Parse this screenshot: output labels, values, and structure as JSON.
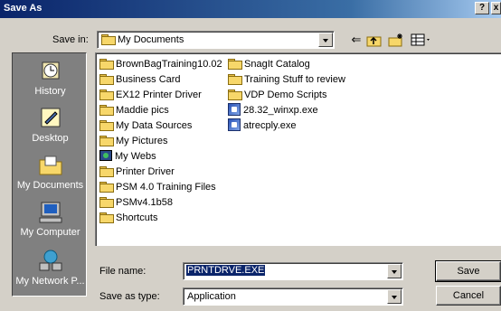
{
  "window": {
    "title": "Save As",
    "help_label": "?",
    "close_label": "x"
  },
  "save_in": {
    "label": "Save in:",
    "value": "My Documents"
  },
  "places": [
    {
      "label": "History",
      "icon": "history-icon"
    },
    {
      "label": "Desktop",
      "icon": "desktop-icon"
    },
    {
      "label": "My Documents",
      "icon": "my-documents-icon"
    },
    {
      "label": "My Computer",
      "icon": "my-computer-icon"
    },
    {
      "label": "My Network P...",
      "icon": "my-network-places-icon"
    }
  ],
  "files": {
    "col1": [
      {
        "name": "BrownBagTraining10.02",
        "icon": "folder"
      },
      {
        "name": "Business Card",
        "icon": "folder"
      },
      {
        "name": "EX12 Printer Driver",
        "icon": "folder"
      },
      {
        "name": "Maddie pics",
        "icon": "folder"
      },
      {
        "name": "My Data Sources",
        "icon": "folder"
      },
      {
        "name": "My Pictures",
        "icon": "folder"
      },
      {
        "name": "My Webs",
        "icon": "web"
      },
      {
        "name": "Printer Driver",
        "icon": "folder"
      },
      {
        "name": "PSM 4.0 Training Files",
        "icon": "folder"
      },
      {
        "name": "PSMv4.1b58",
        "icon": "folder"
      },
      {
        "name": "Shortcuts",
        "icon": "folder"
      }
    ],
    "col2": [
      {
        "name": "SnagIt Catalog",
        "icon": "folder"
      },
      {
        "name": "Training Stuff to review",
        "icon": "folder"
      },
      {
        "name": "VDP Demo Scripts",
        "icon": "folder"
      },
      {
        "name": "28.32_winxp.exe",
        "icon": "exe"
      },
      {
        "name": "atrecply.exe",
        "icon": "exe"
      }
    ]
  },
  "file_name": {
    "label": "File name:",
    "value": "PRNTDRVE.EXE"
  },
  "save_as_type": {
    "label": "Save as type:",
    "value": "Application"
  },
  "buttons": {
    "save": "Save",
    "cancel": "Cancel"
  },
  "toolbar": {
    "back_icon": "back-arrow-icon",
    "up_icon": "up-folder-icon",
    "new_folder_icon": "new-folder-icon",
    "views_icon": "views-menu-icon"
  }
}
